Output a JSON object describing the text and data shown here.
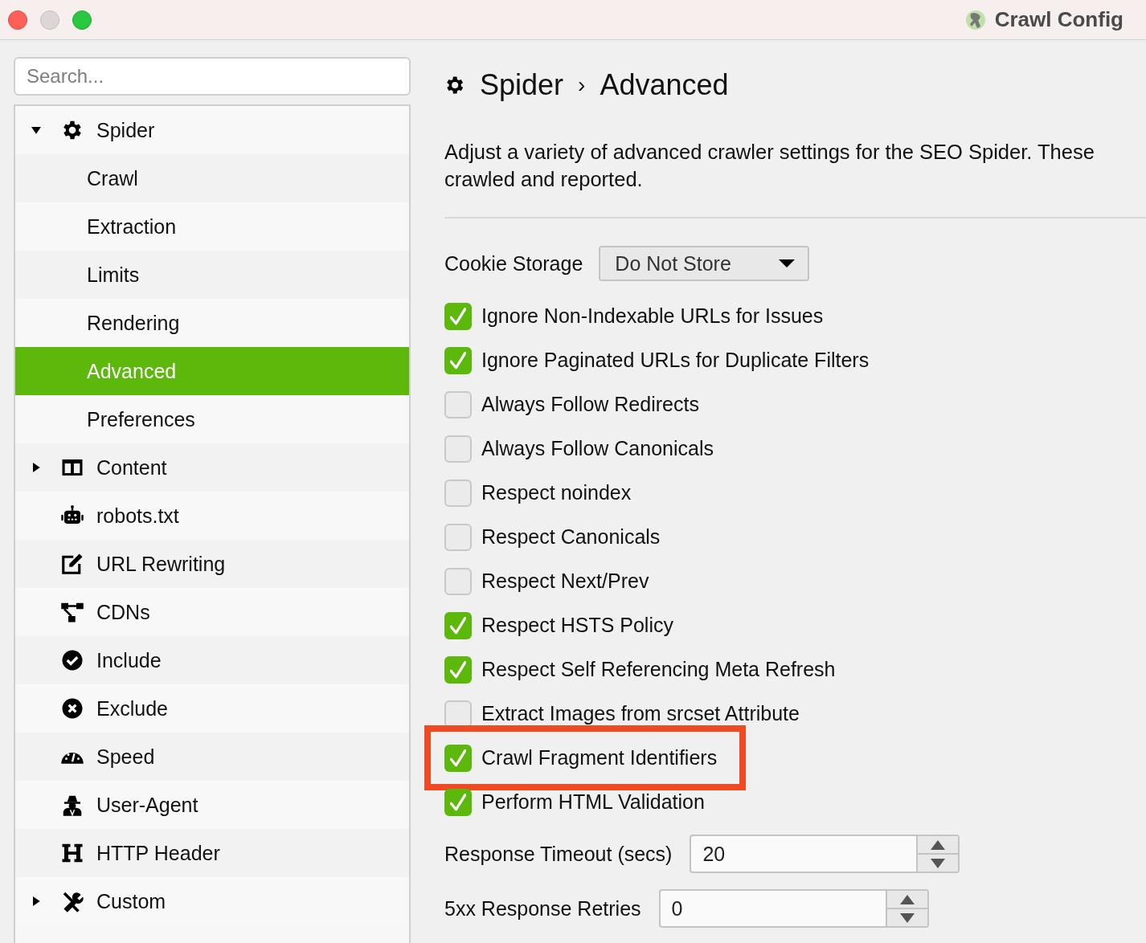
{
  "window": {
    "title": "Crawl Config"
  },
  "search": {
    "placeholder": "Search..."
  },
  "sidebar": {
    "items": [
      {
        "label": "Spider",
        "expanded": true,
        "selected": false,
        "children": [
          {
            "label": "Crawl",
            "selected": false
          },
          {
            "label": "Extraction",
            "selected": false
          },
          {
            "label": "Limits",
            "selected": false
          },
          {
            "label": "Rendering",
            "selected": false
          },
          {
            "label": "Advanced",
            "selected": true
          },
          {
            "label": "Preferences",
            "selected": false
          }
        ]
      },
      {
        "label": "Content",
        "expanded": false,
        "selected": false
      },
      {
        "label": "robots.txt",
        "selected": false
      },
      {
        "label": "URL Rewriting",
        "selected": false
      },
      {
        "label": "CDNs",
        "selected": false
      },
      {
        "label": "Include",
        "selected": false
      },
      {
        "label": "Exclude",
        "selected": false
      },
      {
        "label": "Speed",
        "selected": false
      },
      {
        "label": "User-Agent",
        "selected": false
      },
      {
        "label": "HTTP Header",
        "selected": false
      },
      {
        "label": "Custom",
        "expanded": false,
        "selected": false
      }
    ]
  },
  "breadcrumb": [
    "Spider",
    "›",
    "Advanced"
  ],
  "description_lines": [
    "Adjust a variety of advanced crawler settings for the SEO Spider. These",
    "crawled and reported."
  ],
  "settings": [
    {
      "kind": "dropdown",
      "label": "Cookie Storage",
      "value": "Do Not Store"
    },
    {
      "kind": "checkbox",
      "label": "Ignore Non-Indexable URLs for Issues",
      "checked": true
    },
    {
      "kind": "checkbox",
      "label": "Ignore Paginated URLs for Duplicate Filters",
      "checked": true
    },
    {
      "kind": "checkbox",
      "label": "Always Follow Redirects",
      "checked": false
    },
    {
      "kind": "checkbox",
      "label": "Always Follow Canonicals",
      "checked": false
    },
    {
      "kind": "checkbox",
      "label": "Respect noindex",
      "checked": false
    },
    {
      "kind": "checkbox",
      "label": "Respect Canonicals",
      "checked": false
    },
    {
      "kind": "checkbox",
      "label": "Respect Next/Prev",
      "checked": false
    },
    {
      "kind": "checkbox",
      "label": "Respect HSTS Policy",
      "checked": true
    },
    {
      "kind": "checkbox",
      "label": "Respect Self Referencing Meta Refresh",
      "checked": true
    },
    {
      "kind": "checkbox",
      "label": "Extract Images from srcset Attribute",
      "checked": false
    },
    {
      "kind": "checkbox",
      "label": "Crawl Fragment Identifiers",
      "checked": true,
      "highlighted": true
    },
    {
      "kind": "checkbox",
      "label": "Perform HTML Validation",
      "checked": true
    },
    {
      "kind": "spinner",
      "label": "Response Timeout (secs)",
      "value": "20"
    },
    {
      "kind": "spinner",
      "label": "5xx Response Retries",
      "value": "0"
    }
  ]
}
